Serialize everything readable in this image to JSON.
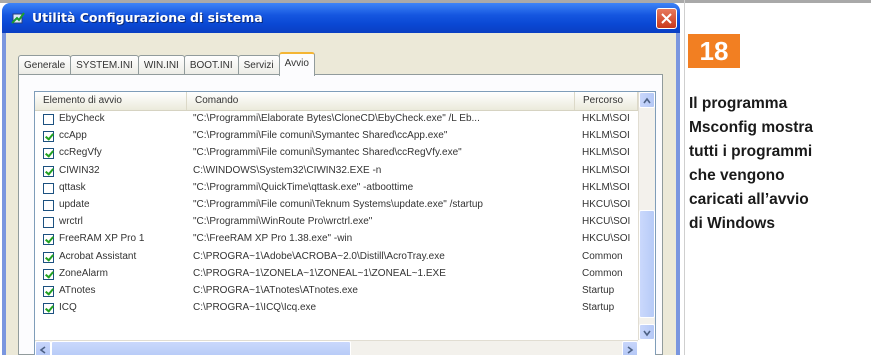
{
  "window": {
    "title": "Utilità Configurazione di sistema",
    "tabs": [
      "Generale",
      "SYSTEM.INI",
      "WIN.INI",
      "BOOT.INI",
      "Servizi",
      "Avvio"
    ],
    "active_tab": "Avvio"
  },
  "list": {
    "columns": {
      "elemento": "Elemento di avvio",
      "comando": "Comando",
      "percorso": "Percorso"
    },
    "rows": [
      {
        "checked": false,
        "name": "EbyCheck",
        "command": "\"C:\\Programmi\\Elaborate Bytes\\CloneCD\\EbyCheck.exe\" /L Eb...",
        "path": "HKLM\\SOI"
      },
      {
        "checked": true,
        "name": "ccApp",
        "command": "\"C:\\Programmi\\File comuni\\Symantec Shared\\ccApp.exe\"",
        "path": "HKLM\\SOI"
      },
      {
        "checked": true,
        "name": "ccRegVfy",
        "command": "\"C:\\Programmi\\File comuni\\Symantec Shared\\ccRegVfy.exe\"",
        "path": "HKLM\\SOI"
      },
      {
        "checked": true,
        "name": "CIWIN32",
        "command": "C:\\WINDOWS\\System32\\CIWIN32.EXE -n",
        "path": "HKLM\\SOI"
      },
      {
        "checked": false,
        "name": "qttask",
        "command": "\"C:\\Programmi\\QuickTime\\qttask.exe\" -atboottime",
        "path": "HKLM\\SOI"
      },
      {
        "checked": false,
        "name": "update",
        "command": "\"C:\\Programmi\\File comuni\\Teknum Systems\\update.exe\" /startup",
        "path": "HKCU\\SOI"
      },
      {
        "checked": false,
        "name": "wrctrl",
        "command": "\"C:\\Programmi\\WinRoute Pro\\wrctrl.exe\"",
        "path": "HKCU\\SOI"
      },
      {
        "checked": true,
        "name": "FreeRAM XP Pro 1",
        "command": "\"C:\\FreeRAM XP Pro 1.38.exe\" -win",
        "path": "HKCU\\SOI"
      },
      {
        "checked": true,
        "name": "Acrobat Assistant",
        "command": "C:\\PROGRA~1\\Adobe\\ACROBA~2.0\\Distill\\AcroTray.exe",
        "path": "Common"
      },
      {
        "checked": true,
        "name": "ZoneAlarm",
        "command": "C:\\PROGRA~1\\ZONELA~1\\ZONEAL~1\\ZONEAL~1.EXE",
        "path": "Common"
      },
      {
        "checked": true,
        "name": "ATnotes",
        "command": "C:\\PROGRA~1\\ATnotes\\ATnotes.exe",
        "path": "Startup"
      },
      {
        "checked": true,
        "name": "ICQ",
        "command": "C:\\PROGRA~1\\ICQ\\Icq.exe",
        "path": "Startup"
      }
    ]
  },
  "caption": {
    "number": "18",
    "lines": [
      "Il programma",
      "Msconfig mostra",
      "tutti i programmi",
      "che vengono",
      "caricati all’avvio",
      "di Windows"
    ]
  },
  "colors": {
    "badge": "#f27f22",
    "titlebar": "#0a48d4",
    "close": "#c9381b"
  }
}
